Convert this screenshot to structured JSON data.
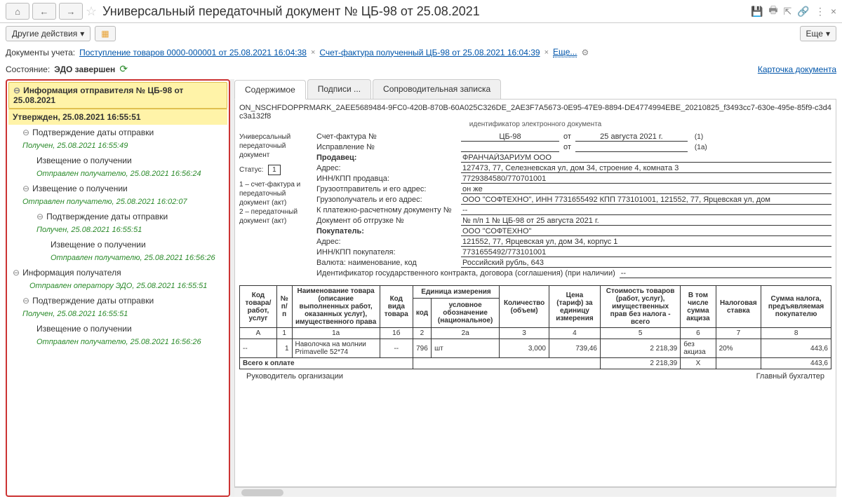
{
  "header": {
    "title": "Универсальный передаточный документ № ЦБ-98 от 25.08.2021"
  },
  "toolbar": {
    "other_actions": "Другие действия",
    "more": "Еще"
  },
  "row3": {
    "label": "Документы учета:",
    "link1": "Поступление товаров 0000-000001 от 25.08.2021 16:04:38",
    "link2": "Счет-фактура полученный ЦБ-98 от 25.08.2021 16:04:39",
    "more_link": "Еще..."
  },
  "row4": {
    "label": "Состояние:",
    "status": "ЭДО завершен",
    "card_link": "Карточка документа"
  },
  "tree": [
    {
      "level": 0,
      "bullet": "⊖",
      "text": "Информация отправителя № ЦБ-98 от 25.08.2021",
      "cls": "sel"
    },
    {
      "level": 0,
      "text": "Утвержден, 25.08.2021 16:55:51",
      "cls": "sub"
    },
    {
      "level": 1,
      "bullet": "⊖",
      "text": "Подтверждение даты отправки"
    },
    {
      "level": 1,
      "status": "Получен, 25.08.2021 16:55:49"
    },
    {
      "level": 2,
      "bullet": "",
      "text": "Извещение о получении"
    },
    {
      "level": 2,
      "status": "Отправлен получателю, 25.08.2021 16:56:24"
    },
    {
      "level": 1,
      "bullet": "⊖",
      "text": "Извещение о получении"
    },
    {
      "level": 1,
      "status": "Отправлен получателю, 25.08.2021 16:02:07"
    },
    {
      "level": 2,
      "bullet": "⊖",
      "text": "Подтверждение даты отправки"
    },
    {
      "level": 2,
      "status": "Получен, 25.08.2021 16:55:51"
    },
    {
      "level": 3,
      "bullet": "",
      "text": "Извещение о получении"
    },
    {
      "level": 3,
      "status": "Отправлен получателю, 25.08.2021 16:56:26"
    },
    {
      "level": 0,
      "bullet": "⊖",
      "text": "Информация получателя"
    },
    {
      "level": 0,
      "status": "Отправлен оператору ЭДО, 25.08.2021 16:55:51"
    },
    {
      "level": 1,
      "bullet": "⊖",
      "text": "Подтверждение даты отправки"
    },
    {
      "level": 1,
      "status": "Получен, 25.08.2021 16:55:51"
    },
    {
      "level": 2,
      "bullet": "",
      "text": "Извещение о получении"
    },
    {
      "level": 2,
      "status": "Отправлен получателю, 25.08.2021 16:56:26"
    }
  ],
  "tabs": {
    "t1": "Содержимое",
    "t2": "Подписи ...",
    "t3": "Сопроводительная записка"
  },
  "doc": {
    "id_line1": "ON_NSCHFDOPPRMARK_2AEE5689484-9FC0-420B-870B-60A025C326DE_2AE3F7A5673-0E95-47E9-8894-DE4774994EBE_20210825_f3493cc7-630e-495e-85f9-c3d4c3a132f8",
    "id_label": "идентификатор электронного документа",
    "upd_label": "Универсальный передаточный документ",
    "status_label": "Статус:",
    "status_value": "1",
    "status_note1": "1 – счет-фактура и передаточный документ (акт)",
    "status_note2": "2 – передаточный документ (акт)",
    "sf_label": "Счет-фактура №",
    "sf_no": "ЦБ-98",
    "sf_from": "от",
    "sf_date": "25 августа 2021 г.",
    "sf_suffix1": "(1)",
    "corr_label": "Исправление №",
    "corr_from": "от",
    "corr_suffix": "(1а)",
    "seller_label": "Продавец:",
    "seller": "ФРАНЧАЙЗАРИУМ ООО",
    "addr_label": "Адрес:",
    "seller_addr": "127473, 77, Селезневская ул, дом 34, строение 4, комната 3",
    "inn_label": "ИНН/КПП продавца:",
    "seller_inn": "7729384580/770701001",
    "shipper_label": "Грузоотправитель и его адрес:",
    "shipper": "он же",
    "consignee_label": "Грузополучатель и его адрес:",
    "consignee": "ООО \"СОФТЕХНО\", ИНН 7731655492 КПП 773101001, 121552, 77, Ярцевская ул, дом",
    "payment_label": "К платежно-расчетному документу №",
    "payment": "--",
    "ship_doc_label": "Документ об отгрузке №",
    "ship_doc": "№ п/п 1 № ЦБ-98 от 25 августа 2021 г.",
    "buyer_label": "Покупатель:",
    "buyer": "ООО \"СОФТЕХНО\"",
    "buyer_addr_label": "Адрес:",
    "buyer_addr": "121552, 77, Ярцевская ул, дом 34, корпус 1",
    "buyer_inn_label": "ИНН/КПП покупателя:",
    "buyer_inn": "7731655492/773101001",
    "currency_label": "Валюта: наименование, код",
    "currency": "Российский рубль, 643",
    "contract_label": "Идентификатор государственного контракта, договора (соглашения) (при наличии)",
    "contract": "--"
  },
  "table": {
    "headers": {
      "h1": "Код товара/ работ, услуг",
      "h2": "№ п/п",
      "h3": "Наименование товара (описание выполненных работ, оказанных услуг), имущественного права",
      "h4": "Код вида товара",
      "h5": "Единица измерения",
      "h5a": "код",
      "h5b": "условное обозначение (национальное)",
      "h6": "Количество (объем)",
      "h7": "Цена (тариф) за единицу измерения",
      "h8": "Стоимость товаров (работ, услуг), имущественных прав без налога - всего",
      "h9": "В том числе сумма акциза",
      "h10": "Налоговая ставка",
      "h11": "Сумма налога, предъявляемая покупателю"
    },
    "num_row": {
      "c1": "А",
      "c2": "1",
      "c3": "1а",
      "c4": "1б",
      "c5": "2",
      "c6": "2а",
      "c7": "3",
      "c8": "4",
      "c9": "5",
      "c10": "6",
      "c11": "7",
      "c12": "8"
    },
    "row1": {
      "code": "--",
      "num": "1",
      "name": "Наволочка на молнии Primavelle 52*74",
      "kind": "--",
      "unit_code": "796",
      "unit": "шт",
      "qty": "3,000",
      "price": "739,46",
      "sum": "2 218,39",
      "excise": "без акциза",
      "rate": "20%",
      "tax": "443,6"
    },
    "total_label": "Всего к оплате",
    "total_sum": "2 218,39",
    "total_x": "X",
    "total_tax": "443,6",
    "footer_left": "Руководитель организации",
    "footer_right": "Главный бухгалтер"
  }
}
